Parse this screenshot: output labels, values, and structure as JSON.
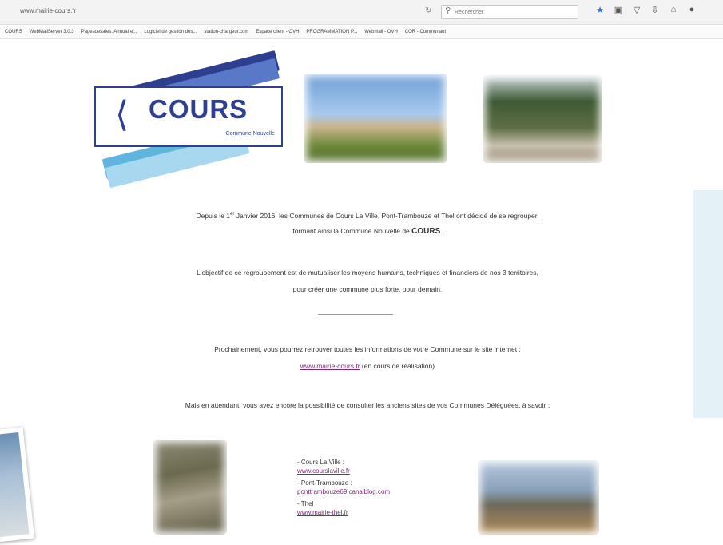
{
  "browser": {
    "url": "www.mairie-cours.fr",
    "search_placeholder": "Rechercher",
    "bookmarks": [
      "COURS",
      "WebMailServer 3.0.3",
      "Pagesdesales. Annuaire...",
      "Logiciel de gestion des...",
      "station-chargeur.com",
      "Espace client - OVH",
      "PROGRAMMATION P...",
      "Webmail - OVH",
      "COR - Communaut"
    ]
  },
  "logo": {
    "title": "COURS",
    "subtitle": "Commune Nouvelle",
    "colors": {
      "primary": "#2f3f8f",
      "stripe1": "#2f3f8f",
      "stripe2": "#5a78c8",
      "stripe3": "#8fb0e0",
      "stripe4": "#5fb5dd",
      "stripe5": "#a8d8ef"
    }
  },
  "intro": {
    "line1_pre": "Depuis le 1",
    "line1_sup": "er",
    "line1_post": " Janvier 2016, les Communes de Cours La Ville, Pont-Trambouze et Thel ont décidé de se regrouper,",
    "line2_pre": "formant ainsi la Commune Nouvelle de ",
    "line2_bold": "COURS",
    "line2_post": "."
  },
  "objective": {
    "line1": "L'objectif de ce regroupement est de mutualiser les moyens humains, techniques et financiers de nos 3 territoires,",
    "line2": "pour créer une commune plus forte, pour demain."
  },
  "announcement": {
    "line1": "Prochainement, vous pourrez retrouver toutes les informations de votre Commune sur le site internet :",
    "link": "www.mairie-cours.fr",
    "link_suffix": " (en cours de réalisation)"
  },
  "meanwhile": "Mais en attendant, vous avez encore la possibilité de consulter les anciens sites de vos Communes Déléguées, à savoir :",
  "communes": [
    {
      "name": "- Cours La Ville :",
      "url": "www.courslaville.fr"
    },
    {
      "name": "- Pont-Trambouze :",
      "url": "ponttrambouze69.canalblog.com"
    },
    {
      "name": "- Thel :",
      "url": "www.mairie-thel.fr"
    }
  ]
}
